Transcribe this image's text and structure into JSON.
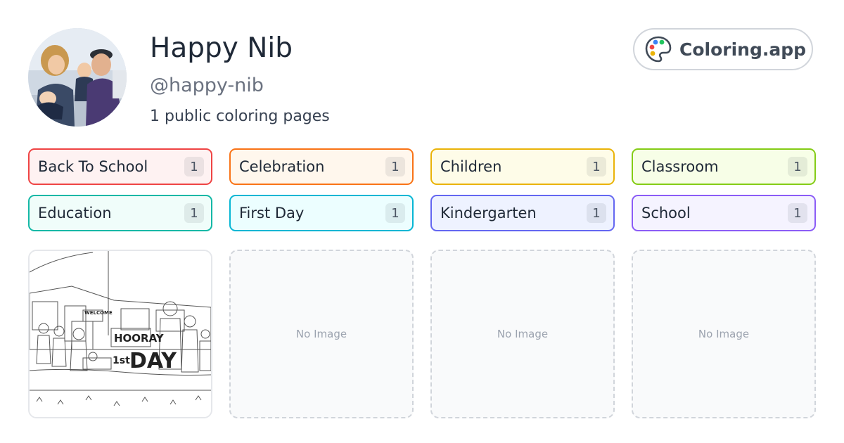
{
  "profile": {
    "name": "Happy Nib",
    "handle": "@happy-nib",
    "page_count_text": "1 public coloring pages"
  },
  "brand": {
    "label": "Coloring.app",
    "icon": "palette-icon",
    "palette_colors": [
      "#ef4444",
      "#3b82f6",
      "#22c55e",
      "#eab308"
    ]
  },
  "tags": [
    {
      "label": "Back To School",
      "count": "1",
      "border": "#ef4444",
      "bg": "#fef2f2"
    },
    {
      "label": "Celebration",
      "count": "1",
      "border": "#f97316",
      "bg": "#fff7ed"
    },
    {
      "label": "Children",
      "count": "1",
      "border": "#eab308",
      "bg": "#fefce8"
    },
    {
      "label": "Classroom",
      "count": "1",
      "border": "#84cc16",
      "bg": "#f7fee7"
    },
    {
      "label": "Education",
      "count": "1",
      "border": "#14b8a6",
      "bg": "#f0fdfa"
    },
    {
      "label": "First Day",
      "count": "1",
      "border": "#06b6d4",
      "bg": "#ecfeff"
    },
    {
      "label": "Kindergarten",
      "count": "1",
      "border": "#6366f1",
      "bg": "#eef2ff"
    },
    {
      "label": "School",
      "count": "1",
      "border": "#8b5cf6",
      "bg": "#f5f3ff"
    }
  ],
  "cards": [
    {
      "has_image": true,
      "image_text": {
        "sign_left": "HOORAY",
        "sign_first": "1st",
        "sign_day": "DAY",
        "sign_small": "WELCOME"
      }
    },
    {
      "has_image": false,
      "empty_label": "No Image"
    },
    {
      "has_image": false,
      "empty_label": "No Image"
    },
    {
      "has_image": false,
      "empty_label": "No Image"
    }
  ]
}
